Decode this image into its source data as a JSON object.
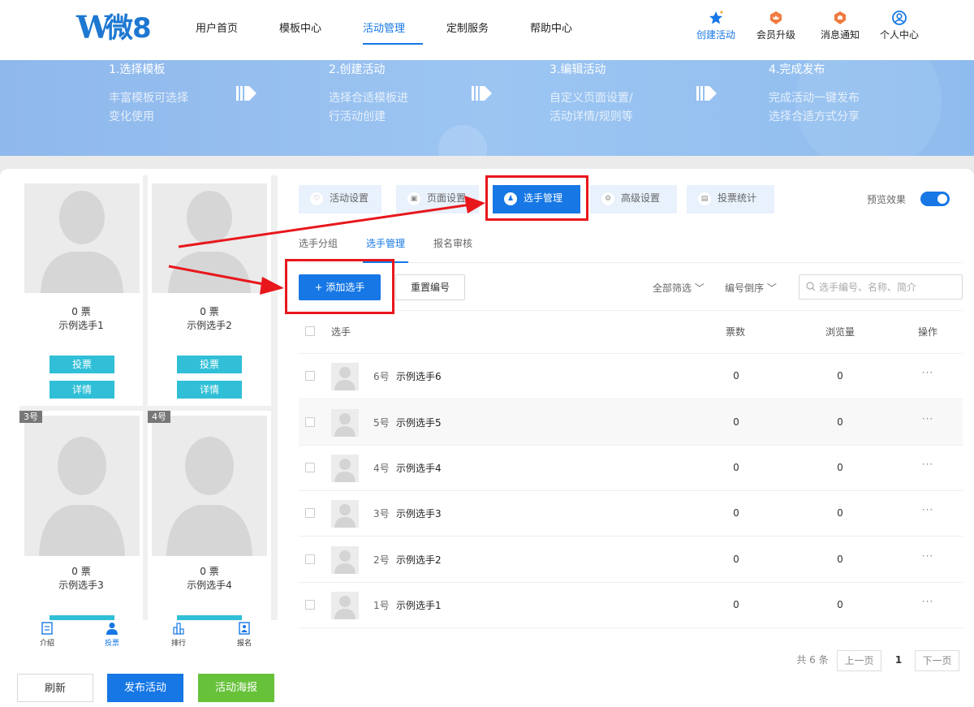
{
  "header": {
    "logo_w": "W",
    "logo_text": "微8",
    "nav": [
      "用户首页",
      "模板中心",
      "活动管理",
      "定制服务",
      "帮助中心"
    ],
    "nav_active_index": 2,
    "icons": [
      {
        "label": "创建活动",
        "icon": "star-icon"
      },
      {
        "label": "会员升级",
        "icon": "crown-badge-icon"
      },
      {
        "label": "消息通知",
        "icon": "bell-badge-icon"
      },
      {
        "label": "个人中心",
        "icon": "user-circle-icon"
      }
    ]
  },
  "banner": {
    "steps": [
      {
        "title": "1.选择模板",
        "desc1": "丰富模板可选择",
        "desc2": "变化使用"
      },
      {
        "title": "2.创建活动",
        "desc1": "选择合适模板进",
        "desc2": "行活动创建"
      },
      {
        "title": "3.编辑活动",
        "desc1": "自定义页面设置/",
        "desc2": "活动详情/规则等"
      },
      {
        "title": "4.完成发布",
        "desc1": "完成活动一键发布",
        "desc2": "选择合适方式分享"
      }
    ]
  },
  "preview": {
    "cards": [
      {
        "votes": "0 票",
        "name": "示例选手1",
        "vote_btn": "投票",
        "detail_btn": "详情"
      },
      {
        "votes": "0 票",
        "name": "示例选手2",
        "vote_btn": "投票",
        "detail_btn": "详情"
      },
      {
        "badge": "3号",
        "votes": "0 票",
        "name": "示例选手3"
      },
      {
        "badge": "4号",
        "votes": "0 票",
        "name": "示例选手4"
      }
    ],
    "bottom_tabs": [
      "介绍",
      "投票",
      "排行",
      "报名"
    ],
    "bottom_active_index": 1
  },
  "actions": {
    "refresh": "刷新",
    "publish": "发布活动",
    "poster": "活动海报"
  },
  "tabs": [
    "活动设置",
    "页面设置",
    "选手管理",
    "高级设置",
    "投票统计"
  ],
  "tab_active_index": 2,
  "preview_toggle": {
    "label": "预览效果",
    "on": true
  },
  "subtabs": [
    "选手分组",
    "选手管理",
    "报名审核"
  ],
  "subtab_active_index": 1,
  "toolbar": {
    "add_button": "+ 添加选手",
    "reset_button": "重置编号",
    "filter_all": "全部筛选",
    "sort": "编号倒序",
    "search_placeholder": "选手编号、名称、简介"
  },
  "table": {
    "headers": {
      "player": "选手",
      "votes": "票数",
      "views": "浏览量",
      "actions": "操作"
    },
    "rows": [
      {
        "no": "6号",
        "name": "示例选手6",
        "votes": "0",
        "views": "0",
        "more": "···"
      },
      {
        "no": "5号",
        "name": "示例选手5",
        "votes": "0",
        "views": "0",
        "more": "···"
      },
      {
        "no": "4号",
        "name": "示例选手4",
        "votes": "0",
        "views": "0",
        "more": "···"
      },
      {
        "no": "3号",
        "name": "示例选手3",
        "votes": "0",
        "views": "0",
        "more": "···"
      },
      {
        "no": "2号",
        "name": "示例选手2",
        "votes": "0",
        "views": "0",
        "more": "···"
      },
      {
        "no": "1号",
        "name": "示例选手1",
        "votes": "0",
        "views": "0",
        "more": "···"
      }
    ]
  },
  "pagination": {
    "total": "共 6 条",
    "prev": "上一页",
    "current": "1",
    "next": "下一页"
  },
  "colors": {
    "primary": "#1677e5",
    "accent": "#30bfd7",
    "poster": "#67c23a",
    "annotation": "#e8171c"
  }
}
